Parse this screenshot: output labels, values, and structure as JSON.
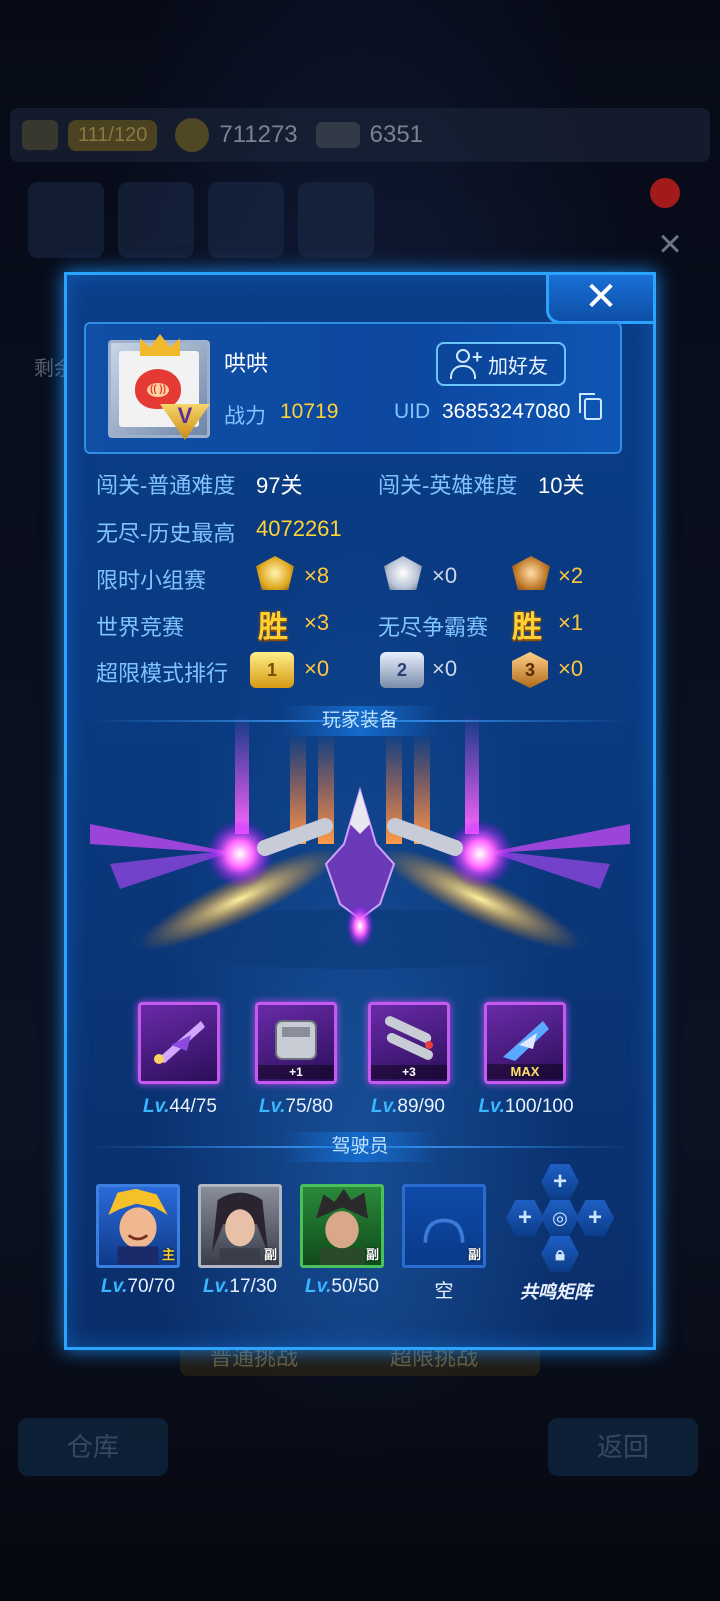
{
  "background": {
    "stamina": "111/120",
    "gold": "711273",
    "wings": "6351",
    "hint_left": "剩余",
    "bottom_left": "仓库",
    "bottom_right": "返回",
    "mid_left": "普通挑战",
    "mid_right": "超限挑战"
  },
  "profile": {
    "nickname": "哄哄",
    "power_label": "战力",
    "power": "10719",
    "uid_label": "UID",
    "uid": "36853247080",
    "add_friend": "加好友",
    "avatar_badge": "V",
    "pig_text": "(( ))"
  },
  "stats": {
    "normal_label": "闯关-普通难度",
    "normal_value": "97关",
    "hero_label": "闯关-英雄难度",
    "hero_value": "10关",
    "endless_label": "无尽-历史最高",
    "endless_value": "4072261",
    "limited_label": "限时小组赛",
    "limited": [
      "×8",
      "×0",
      "×2"
    ],
    "world_label": "世界竞赛",
    "world_win": "胜",
    "world_value": "×3",
    "endless_fight_label": "无尽争霸赛",
    "endless_fight_win": "胜",
    "endless_fight_value": "×1",
    "ultra_label": "超限模式排行",
    "ultra_ranks": [
      "1",
      "2",
      "3"
    ],
    "ultra": [
      "×0",
      "×0",
      "×0"
    ]
  },
  "equipment": {
    "title": "玩家装备",
    "lv_prefix": "Lv.",
    "items": [
      {
        "level": "44/75",
        "tag": ""
      },
      {
        "level": "75/80",
        "tag": "+1"
      },
      {
        "level": "89/90",
        "tag": "+3"
      },
      {
        "level": "100/100",
        "tag": "MAX"
      }
    ]
  },
  "pilots": {
    "title": "驾驶员",
    "lv_prefix": "Lv.",
    "items": [
      {
        "level": "70/70",
        "tag": "主"
      },
      {
        "level": "17/30",
        "tag": "副"
      },
      {
        "level": "50/50",
        "tag": "副"
      },
      {
        "level": "",
        "tag": "副",
        "empty_label": "空"
      }
    ],
    "resonance_label": "共鸣矩阵"
  },
  "close_symbol": "✕"
}
